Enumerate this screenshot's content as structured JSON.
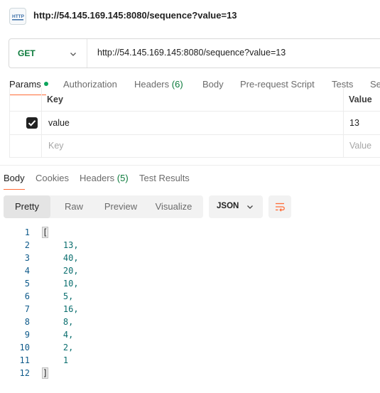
{
  "title": {
    "icon": "http-icon",
    "text": "http://54.145.169.145:8080/sequence?value=13"
  },
  "request": {
    "method": "GET",
    "url": "http://54.145.169.145:8080/sequence?value=13"
  },
  "request_tabs": {
    "params": "Params",
    "authorization": "Authorization",
    "headers": "Headers",
    "headers_count": "(6)",
    "body": "Body",
    "prerequest": "Pre-request Script",
    "tests": "Tests",
    "settings": "Se"
  },
  "params": {
    "key_header": "Key",
    "value_header": "Value",
    "rows": [
      {
        "checked": true,
        "key": "value",
        "value": "13"
      }
    ],
    "key_placeholder": "Key",
    "value_placeholder": "Value"
  },
  "response_tabs": {
    "body": "Body",
    "cookies": "Cookies",
    "headers": "Headers",
    "headers_count": "(5)",
    "test_results": "Test Results"
  },
  "toolbar": {
    "pretty": "Pretty",
    "raw": "Raw",
    "preview": "Preview",
    "visualize": "Visualize",
    "format": "JSON"
  },
  "code": {
    "lines": [
      "[",
      "    13,",
      "    40,",
      "    20,",
      "    10,",
      "    5,",
      "    16,",
      "    8,",
      "    4,",
      "    2,",
      "    1",
      "]"
    ]
  },
  "colors": {
    "accent": "#ff6c37",
    "method": "#0b7a3b",
    "active_dot": "#0ca55c",
    "line_numbers": "#0e5a8a",
    "json_numbers": "#0a6e6e"
  }
}
